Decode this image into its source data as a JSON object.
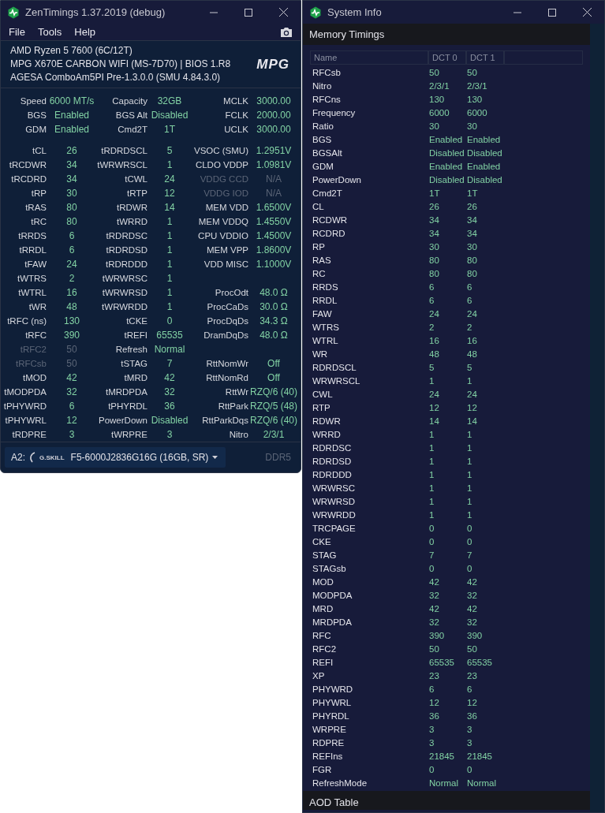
{
  "zentimings": {
    "window": {
      "title": "ZenTimings 1.37.2019 (debug)"
    },
    "menu": [
      "File",
      "Tools",
      "Help"
    ],
    "system_lines": [
      "AMD Ryzen 5 7600 (6C/12T)",
      "MPG X670E CARBON WIFI (MS-7D70) | BIOS 1.R8",
      "AGESA ComboAm5PI Pre-1.3.0.0 (SMU 4.84.3.0)"
    ],
    "logo_text": "MPG",
    "top_rows": [
      {
        "cells": [
          {
            "label": "Speed",
            "value": "6000 MT/s",
            "disabled": false
          },
          {
            "label": "Capacity",
            "value": "32GB",
            "disabled": false
          },
          {
            "label": "MCLK",
            "value": "3000.00",
            "disabled": false
          }
        ]
      },
      {
        "cells": [
          {
            "label": "BGS",
            "value": "Enabled",
            "disabled": false
          },
          {
            "label": "BGS Alt",
            "value": "Disabled",
            "disabled": false
          },
          {
            "label": "FCLK",
            "value": "2000.00",
            "disabled": false
          }
        ]
      },
      {
        "cells": [
          {
            "label": "GDM",
            "value": "Enabled",
            "disabled": false
          },
          {
            "label": "Cmd2T",
            "value": "1T",
            "disabled": false
          },
          {
            "label": "UCLK",
            "value": "3000.00",
            "disabled": false
          }
        ]
      }
    ],
    "timing_rows": [
      {
        "cells": [
          {
            "label": "tCL",
            "value": "26",
            "disabled": false
          },
          {
            "label": "tRDRDSCL",
            "value": "5",
            "disabled": false
          },
          {
            "label": "VSOC (SMU)",
            "value": "1.2951V",
            "disabled": false
          }
        ]
      },
      {
        "cells": [
          {
            "label": "tRCDWR",
            "value": "34",
            "disabled": false
          },
          {
            "label": "tWRWRSCL",
            "value": "1",
            "disabled": false
          },
          {
            "label": "CLDO VDDP",
            "value": "1.0981V",
            "disabled": false
          }
        ]
      },
      {
        "cells": [
          {
            "label": "tRCDRD",
            "value": "34",
            "disabled": false
          },
          {
            "label": "tCWL",
            "value": "24",
            "disabled": false
          },
          {
            "label": "VDDG CCD",
            "value": "N/A",
            "disabled": true
          }
        ]
      },
      {
        "cells": [
          {
            "label": "tRP",
            "value": "30",
            "disabled": false
          },
          {
            "label": "tRTP",
            "value": "12",
            "disabled": false
          },
          {
            "label": "VDDG IOD",
            "value": "N/A",
            "disabled": true
          }
        ]
      },
      {
        "cells": [
          {
            "label": "tRAS",
            "value": "80",
            "disabled": false
          },
          {
            "label": "tRDWR",
            "value": "14",
            "disabled": false
          },
          {
            "label": "MEM VDD",
            "value": "1.6500V",
            "disabled": false
          }
        ]
      },
      {
        "cells": [
          {
            "label": "tRC",
            "value": "80",
            "disabled": false
          },
          {
            "label": "tWRRD",
            "value": "1",
            "disabled": false
          },
          {
            "label": "MEM VDDQ",
            "value": "1.4550V",
            "disabled": false
          }
        ]
      },
      {
        "cells": [
          {
            "label": "tRRDS",
            "value": "6",
            "disabled": false
          },
          {
            "label": "tRDRDSC",
            "value": "1",
            "disabled": false
          },
          {
            "label": "CPU VDDIO",
            "value": "1.4500V",
            "disabled": false
          }
        ]
      },
      {
        "cells": [
          {
            "label": "tRRDL",
            "value": "6",
            "disabled": false
          },
          {
            "label": "tRDRDSD",
            "value": "1",
            "disabled": false
          },
          {
            "label": "MEM VPP",
            "value": "1.8600V",
            "disabled": false
          }
        ]
      },
      {
        "cells": [
          {
            "label": "tFAW",
            "value": "24",
            "disabled": false
          },
          {
            "label": "tRDRDDD",
            "value": "1",
            "disabled": false
          },
          {
            "label": "VDD MISC",
            "value": "1.1000V",
            "disabled": false
          }
        ]
      },
      {
        "cells": [
          {
            "label": "tWTRS",
            "value": "2",
            "disabled": false
          },
          {
            "label": "tWRWRSC",
            "value": "1",
            "disabled": false
          }
        ]
      },
      {
        "cells": [
          {
            "label": "tWTRL",
            "value": "16",
            "disabled": false
          },
          {
            "label": "tWRWRSD",
            "value": "1",
            "disabled": false
          },
          {
            "label": "ProcOdt",
            "value": "48.0 Ω",
            "disabled": false
          }
        ]
      },
      {
        "cells": [
          {
            "label": "tWR",
            "value": "48",
            "disabled": false
          },
          {
            "label": "tWRWRDD",
            "value": "1",
            "disabled": false
          },
          {
            "label": "ProcCaDs",
            "value": "30.0 Ω",
            "disabled": false
          }
        ]
      },
      {
        "cells": [
          {
            "label": "tRFC (ns)",
            "value": "130",
            "disabled": false
          },
          {
            "label": "tCKE",
            "value": "0",
            "disabled": false
          },
          {
            "label": "ProcDqDs",
            "value": "34.3 Ω",
            "disabled": false
          }
        ]
      },
      {
        "cells": [
          {
            "label": "tRFC",
            "value": "390",
            "disabled": false
          },
          {
            "label": "tREFI",
            "value": "65535",
            "disabled": false
          },
          {
            "label": "DramDqDs",
            "value": "48.0 Ω",
            "disabled": false
          }
        ]
      },
      {
        "cells": [
          {
            "label": "tRFC2",
            "value": "50",
            "disabled": true
          },
          {
            "label": "Refresh",
            "value": "Normal",
            "disabled": false
          }
        ]
      },
      {
        "cells": [
          {
            "label": "tRFCsb",
            "value": "50",
            "disabled": true
          },
          {
            "label": "tSTAG",
            "value": "7",
            "disabled": false
          },
          {
            "label": "RttNomWr",
            "value": "Off",
            "disabled": false
          }
        ]
      },
      {
        "cells": [
          {
            "label": "tMOD",
            "value": "42",
            "disabled": false
          },
          {
            "label": "tMRD",
            "value": "42",
            "disabled": false
          },
          {
            "label": "RttNomRd",
            "value": "Off",
            "disabled": false
          }
        ]
      },
      {
        "cells": [
          {
            "label": "tMODPDA",
            "value": "32",
            "disabled": false
          },
          {
            "label": "tMRDPDA",
            "value": "32",
            "disabled": false
          },
          {
            "label": "RttWr",
            "value": "RZQ/6 (40)",
            "disabled": false
          }
        ]
      },
      {
        "cells": [
          {
            "label": "tPHYWRD",
            "value": "6",
            "disabled": false
          },
          {
            "label": "tPHYRDL",
            "value": "36",
            "disabled": false
          },
          {
            "label": "RttPark",
            "value": "RZQ/5 (48)",
            "disabled": false
          }
        ]
      },
      {
        "cells": [
          {
            "label": "tPHYWRL",
            "value": "12",
            "disabled": false
          },
          {
            "label": "PowerDown",
            "value": "Disabled",
            "disabled": false
          },
          {
            "label": "RttParkDqs",
            "value": "RZQ/6 (40)",
            "disabled": false
          }
        ]
      },
      {
        "cells": [
          {
            "label": "tRDPRE",
            "value": "3",
            "disabled": false
          },
          {
            "label": "tWRPRE",
            "value": "3",
            "disabled": false
          },
          {
            "label": "Nitro",
            "value": "2/3/1",
            "disabled": false
          }
        ]
      }
    ],
    "module_select": {
      "slot": "A2:",
      "brand": "G.SKILL",
      "value": "F5-6000J2836G16G (16GB, SR)"
    },
    "memory_type": "DDR5"
  },
  "system_info": {
    "window": {
      "title": "System Info"
    },
    "section_title": "Memory Timings",
    "table": {
      "columns": [
        "Name",
        "DCT 0",
        "DCT 1"
      ],
      "rows": [
        {
          "name": "RFCsb",
          "dct_0": "50",
          "dct_1": "50"
        },
        {
          "name": "Nitro",
          "dct_0": "2/3/1",
          "dct_1": "2/3/1"
        },
        {
          "name": "RFCns",
          "dct_0": "130",
          "dct_1": "130"
        },
        {
          "name": "Frequency",
          "dct_0": "6000",
          "dct_1": "6000"
        },
        {
          "name": "Ratio",
          "dct_0": "30",
          "dct_1": "30"
        },
        {
          "name": "BGS",
          "dct_0": "Enabled",
          "dct_1": "Enabled"
        },
        {
          "name": "BGSAlt",
          "dct_0": "Disabled",
          "dct_1": "Disabled"
        },
        {
          "name": "GDM",
          "dct_0": "Enabled",
          "dct_1": "Enabled"
        },
        {
          "name": "PowerDown",
          "dct_0": "Disabled",
          "dct_1": "Disabled"
        },
        {
          "name": "Cmd2T",
          "dct_0": "1T",
          "dct_1": "1T"
        },
        {
          "name": "CL",
          "dct_0": "26",
          "dct_1": "26"
        },
        {
          "name": "RCDWR",
          "dct_0": "34",
          "dct_1": "34"
        },
        {
          "name": "RCDRD",
          "dct_0": "34",
          "dct_1": "34"
        },
        {
          "name": "RP",
          "dct_0": "30",
          "dct_1": "30"
        },
        {
          "name": "RAS",
          "dct_0": "80",
          "dct_1": "80"
        },
        {
          "name": "RC",
          "dct_0": "80",
          "dct_1": "80"
        },
        {
          "name": "RRDS",
          "dct_0": "6",
          "dct_1": "6"
        },
        {
          "name": "RRDL",
          "dct_0": "6",
          "dct_1": "6"
        },
        {
          "name": "FAW",
          "dct_0": "24",
          "dct_1": "24"
        },
        {
          "name": "WTRS",
          "dct_0": "2",
          "dct_1": "2"
        },
        {
          "name": "WTRL",
          "dct_0": "16",
          "dct_1": "16"
        },
        {
          "name": "WR",
          "dct_0": "48",
          "dct_1": "48"
        },
        {
          "name": "RDRDSCL",
          "dct_0": "5",
          "dct_1": "5"
        },
        {
          "name": "WRWRSCL",
          "dct_0": "1",
          "dct_1": "1"
        },
        {
          "name": "CWL",
          "dct_0": "24",
          "dct_1": "24"
        },
        {
          "name": "RTP",
          "dct_0": "12",
          "dct_1": "12"
        },
        {
          "name": "RDWR",
          "dct_0": "14",
          "dct_1": "14"
        },
        {
          "name": "WRRD",
          "dct_0": "1",
          "dct_1": "1"
        },
        {
          "name": "RDRDSC",
          "dct_0": "1",
          "dct_1": "1"
        },
        {
          "name": "RDRDSD",
          "dct_0": "1",
          "dct_1": "1"
        },
        {
          "name": "RDRDDD",
          "dct_0": "1",
          "dct_1": "1"
        },
        {
          "name": "WRWRSC",
          "dct_0": "1",
          "dct_1": "1"
        },
        {
          "name": "WRWRSD",
          "dct_0": "1",
          "dct_1": "1"
        },
        {
          "name": "WRWRDD",
          "dct_0": "1",
          "dct_1": "1"
        },
        {
          "name": "TRCPAGE",
          "dct_0": "0",
          "dct_1": "0"
        },
        {
          "name": "CKE",
          "dct_0": "0",
          "dct_1": "0"
        },
        {
          "name": "STAG",
          "dct_0": "7",
          "dct_1": "7"
        },
        {
          "name": "STAGsb",
          "dct_0": "0",
          "dct_1": "0"
        },
        {
          "name": "MOD",
          "dct_0": "42",
          "dct_1": "42"
        },
        {
          "name": "MODPDA",
          "dct_0": "32",
          "dct_1": "32"
        },
        {
          "name": "MRD",
          "dct_0": "42",
          "dct_1": "42"
        },
        {
          "name": "MRDPDA",
          "dct_0": "32",
          "dct_1": "32"
        },
        {
          "name": "RFC",
          "dct_0": "390",
          "dct_1": "390"
        },
        {
          "name": "RFC2",
          "dct_0": "50",
          "dct_1": "50"
        },
        {
          "name": "REFI",
          "dct_0": "65535",
          "dct_1": "65535"
        },
        {
          "name": "XP",
          "dct_0": "23",
          "dct_1": "23"
        },
        {
          "name": "PHYWRD",
          "dct_0": "6",
          "dct_1": "6"
        },
        {
          "name": "PHYWRL",
          "dct_0": "12",
          "dct_1": "12"
        },
        {
          "name": "PHYRDL",
          "dct_0": "36",
          "dct_1": "36"
        },
        {
          "name": "WRPRE",
          "dct_0": "3",
          "dct_1": "3"
        },
        {
          "name": "RDPRE",
          "dct_0": "3",
          "dct_1": "3"
        },
        {
          "name": "REFIns",
          "dct_0": "21845",
          "dct_1": "21845"
        },
        {
          "name": "FGR",
          "dct_0": "0",
          "dct_1": "0"
        },
        {
          "name": "RefreshMode",
          "dct_0": "Normal",
          "dct_1": "Normal"
        }
      ]
    },
    "next_section_title": "AOD Table"
  }
}
